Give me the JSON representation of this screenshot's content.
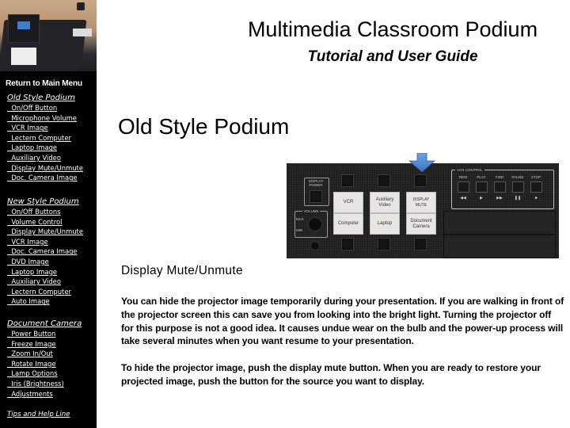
{
  "header": {
    "title": "Multimedia Classroom Podium",
    "subtitle": "Tutorial and User Guide"
  },
  "sidebar": {
    "main_menu": "Return to Main Menu",
    "sections": [
      {
        "title": "Old Style Podium",
        "items": [
          "On/Off Button",
          "Microphone Volume",
          "VCR Image",
          "Lectern Computer",
          "Laptop Image",
          "Auxiliary Video",
          "Display Mute/Unmute",
          "Doc. Camera Image"
        ]
      },
      {
        "title": "New Style Podium",
        "items": [
          "On/Off Buttons",
          "Volume Control",
          "Display Mute/Unmute",
          "VCR Image",
          "Doc. Camera Image",
          "DVD Image",
          "Laptop Image",
          "Auxiliary Video",
          "Lectern Computer",
          "Auto Image"
        ]
      },
      {
        "title": "Document Camera",
        "items": [
          "Power Button",
          "Freeze Image",
          "Zoom In/Out",
          "Rotate Image",
          "Lamp Options",
          "Iris (Brightness)",
          "Adjustments"
        ]
      }
    ],
    "tips": "Tips and Help Line"
  },
  "main": {
    "section_heading": "Old Style Podium",
    "topic_heading": "Display Mute/Unmute",
    "paragraphs": [
      "You can hide the projector image temporarily during your presentation. If you are walking in front of the projector screen this can save you from looking into the bright light. Turning the projector off for this purpose is not a good idea. It causes undue wear on the bulb and the power-up process will take several minutes when you want resume to your presentation.",
      "To hide the projector image, push the display mute button. When you are ready to restore your projected image, push the button for the source you want to display."
    ]
  },
  "panel": {
    "display_power_label": "DISPLAY POWER",
    "volume_label": "VOLUME",
    "volume_max": "MAX",
    "volume_min": "MIN",
    "buttons": [
      "VCR",
      "Auxiliary Video",
      "DISPLAY MUTE",
      "Computer",
      "Laptop",
      "Document Camera"
    ],
    "vcr_control_label": "VCR CONTROL",
    "vcr_buttons": [
      "REW",
      "PLAY",
      "FWD",
      "PAUSE",
      "STOP"
    ],
    "vcr_symbols": [
      "◀◀",
      "▶",
      "▶▶",
      "❚❚",
      "■"
    ],
    "arrow_color": "#4a86d4"
  }
}
